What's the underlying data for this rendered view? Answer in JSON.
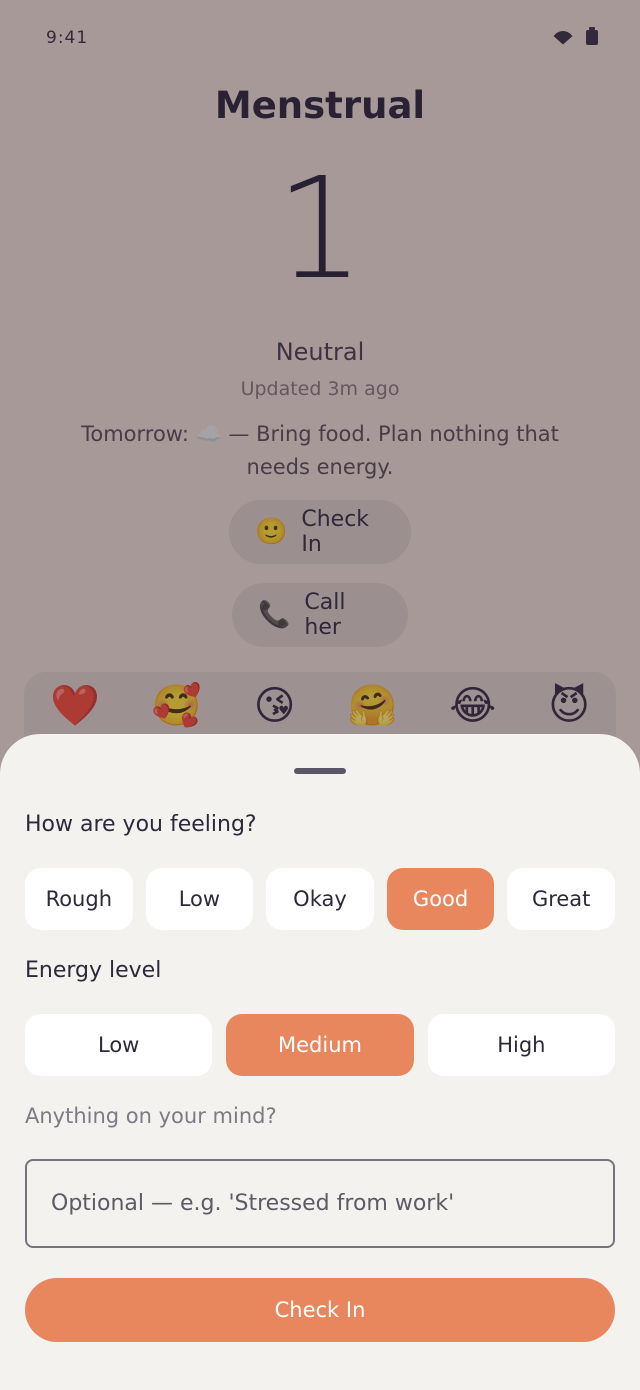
{
  "status_bar": {
    "time": "9:41",
    "wifi_icon": "wifi-icon",
    "battery_icon": "battery-icon"
  },
  "main": {
    "phase": "Menstrual",
    "day": "1",
    "mood": "Neutral",
    "updated": "Updated 3m ago",
    "tomorrow": "Tomorrow: ☁️ — Bring food. Plan nothing that needs energy.",
    "checkin_pill": {
      "emoji": "🙂",
      "label": "Check In"
    },
    "call_pill": {
      "emoji": "📞",
      "label": "Call her"
    },
    "reactions": [
      "❤️",
      "🥰",
      "😘",
      "🤗",
      "😂",
      "😈"
    ]
  },
  "sheet": {
    "feeling_label": "How are you feeling?",
    "feelings": [
      "Rough",
      "Low",
      "Okay",
      "Good",
      "Great"
    ],
    "feeling_selected": "Good",
    "energy_label": "Energy level",
    "energy_levels": [
      "Low",
      "Medium",
      "High"
    ],
    "energy_selected": "Medium",
    "mind_label": "Anything on your mind?",
    "note_placeholder": "Optional — e.g. 'Stressed from work'",
    "submit_label": "Check In"
  },
  "colors": {
    "accent": "#e8865e",
    "sheet_bg": "#f4f2ef",
    "screen_bg": "#e9dcd5",
    "text_dark": "#1f1a36"
  }
}
